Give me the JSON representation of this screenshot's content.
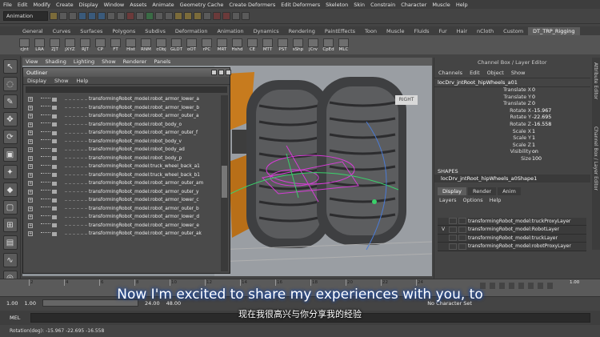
{
  "menubar": [
    "File",
    "Edit",
    "Modify",
    "Create",
    "Display",
    "Window",
    "Assets",
    "Animate",
    "Geometry Cache",
    "Create Deformers",
    "Edit Deformers",
    "Skeleton",
    "Skin",
    "Constrain",
    "Character",
    "Muscle",
    "Help"
  ],
  "status": {
    "mode": "Animation"
  },
  "shelf_tabs": [
    "General",
    "Curves",
    "Surfaces",
    "Polygons",
    "Subdivs",
    "Deformation",
    "Animation",
    "Dynamics",
    "Rendering",
    "PaintEffects",
    "Toon",
    "Muscle",
    "Fluids",
    "Fur",
    "Hair",
    "nCloth",
    "Custom",
    "DT_TRP_Rigging"
  ],
  "shelf_tab_active": "DT_TRP_Rigging",
  "shelf_buttons": [
    "cJnt",
    "LRA",
    "ZJT",
    "jXYZ",
    "RJT",
    "CP",
    "FT",
    "Hist",
    "RNM",
    "cObj",
    "GLDT",
    "oOT",
    "rPC",
    "MRT",
    "Hshd",
    "CE",
    "MTT",
    "PST",
    "sShp",
    "jCrv",
    "CpEd",
    "MLC"
  ],
  "viewport": {
    "menu": [
      "View",
      "Shading",
      "Lighting",
      "Show",
      "Renderer",
      "Panels"
    ],
    "viewcube_label": "RIGHT"
  },
  "outliner": {
    "title": "Outliner",
    "menu": [
      "Display",
      "Show",
      "Help"
    ],
    "items": [
      "transformingRobot_model:robot_armor_lower_a",
      "transformingRobot_model:robot_armor_lower_b",
      "transformingRobot_model:robot_armor_outer_a",
      "transformingRobot_model:robot_body_o",
      "transformingRobot_model:robot_armor_outer_f",
      "transformingRobot_model:robot_body_v",
      "transformingRobot_model:robot_body_ad",
      "transformingRobot_model:robot_body_p",
      "transformingRobot_model:truck_wheel_back_a1",
      "transformingRobot_model:truck_wheel_back_b1",
      "transformingRobot_model:robot_armor_outer_am",
      "transformingRobot_model:robot_armor_outer_y",
      "transformingRobot_model:robot_armor_lower_c",
      "transformingRobot_model:robot_armor_outer_b",
      "transformingRobot_model:robot_armor_lower_d",
      "transformingRobot_model:robot_armor_lower_e",
      "transformingRobot_model:robot_armor_outer_ak"
    ]
  },
  "channel_box": {
    "title": "Channel Box / Layer Editor",
    "menu": [
      "Channels",
      "Edit",
      "Object",
      "Show"
    ],
    "selected": "locDrv_jntRoot_hipWheels_a01",
    "attributes": [
      {
        "name": "Translate X",
        "value": "0"
      },
      {
        "name": "Translate Y",
        "value": "0"
      },
      {
        "name": "Translate Z",
        "value": "0"
      },
      {
        "name": "Rotate X",
        "value": "-15.967"
      },
      {
        "name": "Rotate Y",
        "value": "-22.695"
      },
      {
        "name": "Rotate Z",
        "value": "-16.558"
      },
      {
        "name": "Scale X",
        "value": "1"
      },
      {
        "name": "Scale Y",
        "value": "1"
      },
      {
        "name": "Scale Z",
        "value": "1"
      },
      {
        "name": "Visibility",
        "value": "on"
      },
      {
        "name": "Size",
        "value": "100"
      }
    ],
    "shapes_header": "SHAPES",
    "shape": "locDrv_jntRoot_hipWheels_a0Shape1",
    "tabs": [
      "Display",
      "Render",
      "Anim"
    ],
    "active_tab": "Display",
    "layer_menu": [
      "Layers",
      "Options",
      "Help"
    ],
    "layers": [
      {
        "vis": "",
        "name": "transformingRobot_model:truckProxyLayer"
      },
      {
        "vis": "V",
        "name": "transformingRobot_model:RobotLayer"
      },
      {
        "vis": "",
        "name": "transformingRobot_model:truckLayer"
      },
      {
        "vis": "",
        "name": "transformingRobot_model:robotProxyLayer"
      }
    ]
  },
  "side_tabs": [
    "Attribute Editor",
    "Channel Box / Layer Editor"
  ],
  "timeline": {
    "ticks": [
      "2",
      "4",
      "6",
      "8",
      "10",
      "12",
      "14",
      "16",
      "18",
      "20",
      "22",
      "24"
    ],
    "current_frame": "1.00"
  },
  "range": {
    "start": "1.00",
    "start2": "1.00",
    "end": "24.00",
    "end2": "48.00",
    "char_set": "No Character Set"
  },
  "command": {
    "label": "MEL"
  },
  "help_line": "Rotation(deg): -15.967 -22.695 -16.558",
  "subtitles": {
    "en": "Now I'm excited to share my experiences with you, to",
    "zh": "现在我很高兴与你分享我的经验"
  }
}
